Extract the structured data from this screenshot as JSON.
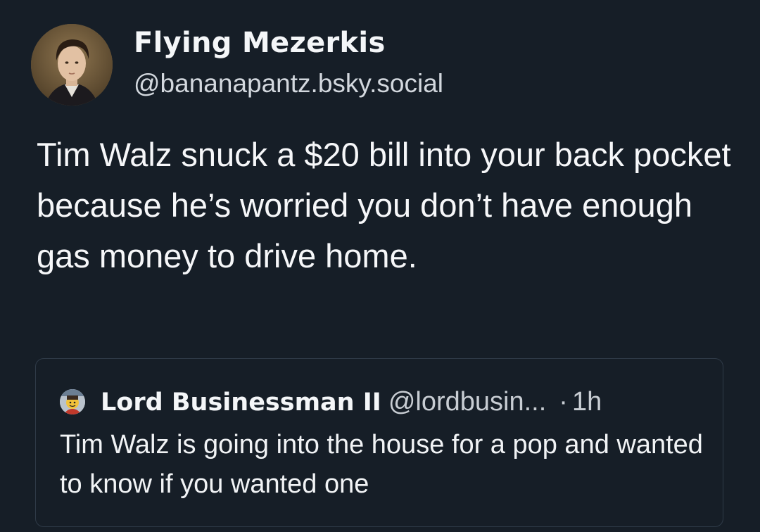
{
  "post": {
    "author_name": "Flying Mezerkis",
    "author_handle": "@bananapantz.bsky.social",
    "text": "Tim Walz snuck a $20 bill into your back pocket because he’s worried you don’t have enough gas money to drive home."
  },
  "quote": {
    "author_name": "Lord Businessman II",
    "author_handle": "@lordbusin...",
    "separator": "·",
    "time": "1h",
    "text": "Tim Walz is going into the house for a pop and wanted to know if you wanted one"
  },
  "colors": {
    "background": "#161e27",
    "text": "#f1f3f5",
    "muted": "#c8cdd3",
    "card_border": "#2f3b48"
  }
}
